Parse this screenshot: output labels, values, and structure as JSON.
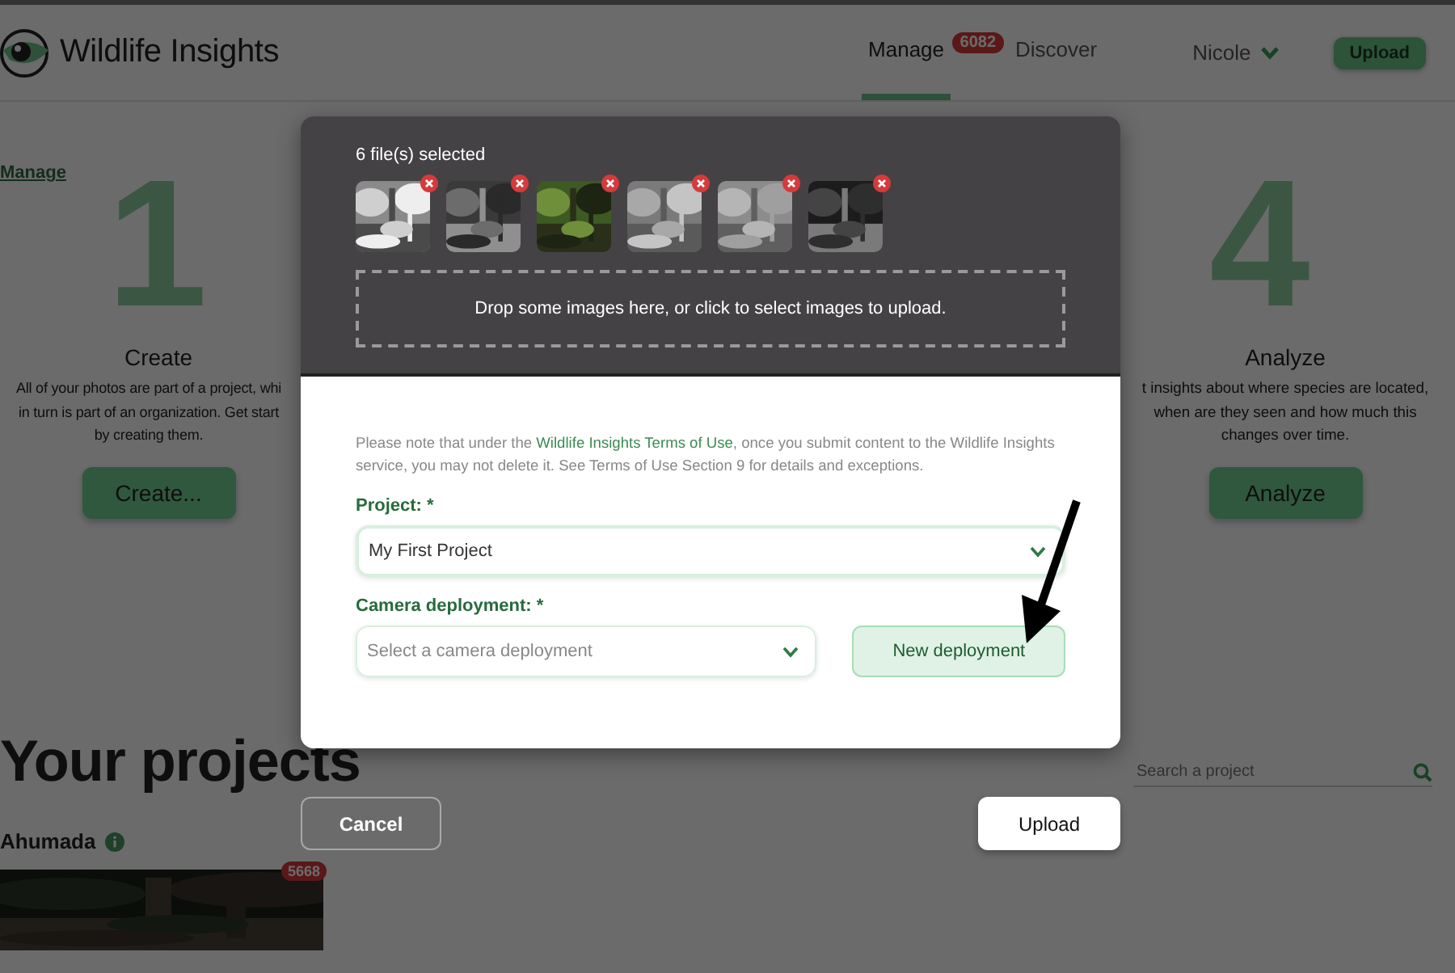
{
  "header": {
    "logo": "Wildlife Insights",
    "nav": [
      {
        "label": "Manage",
        "selected": true,
        "badge": "6082"
      },
      {
        "label": "Discover",
        "selected": false
      }
    ],
    "user": "Nicole",
    "upload_button": "Upload"
  },
  "breadcrumb": "Manage",
  "steps": [
    {
      "number": "1",
      "title": "Create",
      "lines": [
        "All of your photos are part of a project, whi",
        "in turn is part of an organization. Get start",
        "by creating them."
      ],
      "button": "Create..."
    },
    {
      "number": "4",
      "title": "Analyze",
      "lines": [
        "t insights about where species are located,",
        "when are they seen and how much this",
        "changes over time."
      ],
      "button": "Analyze"
    }
  ],
  "projects": {
    "heading": "Your projects",
    "search": {
      "placeholder": "Search a project"
    },
    "items": [
      {
        "name": "Ahumada",
        "count": "5668"
      }
    ]
  },
  "modal": {
    "files_label": "6 file(s) selected",
    "dropzone": "Drop some images here, or click to select images to upload.",
    "notice": {
      "before": "Please note that under the ",
      "link": "Wildlife Insights Terms of Use",
      "after": ", once you submit content to the Wildlife Insights service, you may not delete it. See Terms of Use Section 9 for details and exceptions."
    },
    "project_field": {
      "label": "Project: *",
      "value": "My First Project"
    },
    "deployment_field": {
      "label": "Camera deployment: *",
      "placeholder": "Select a camera deployment"
    },
    "new_deployment_button": "New deployment",
    "cancel_button": "Cancel",
    "submit_button": "Upload"
  }
}
